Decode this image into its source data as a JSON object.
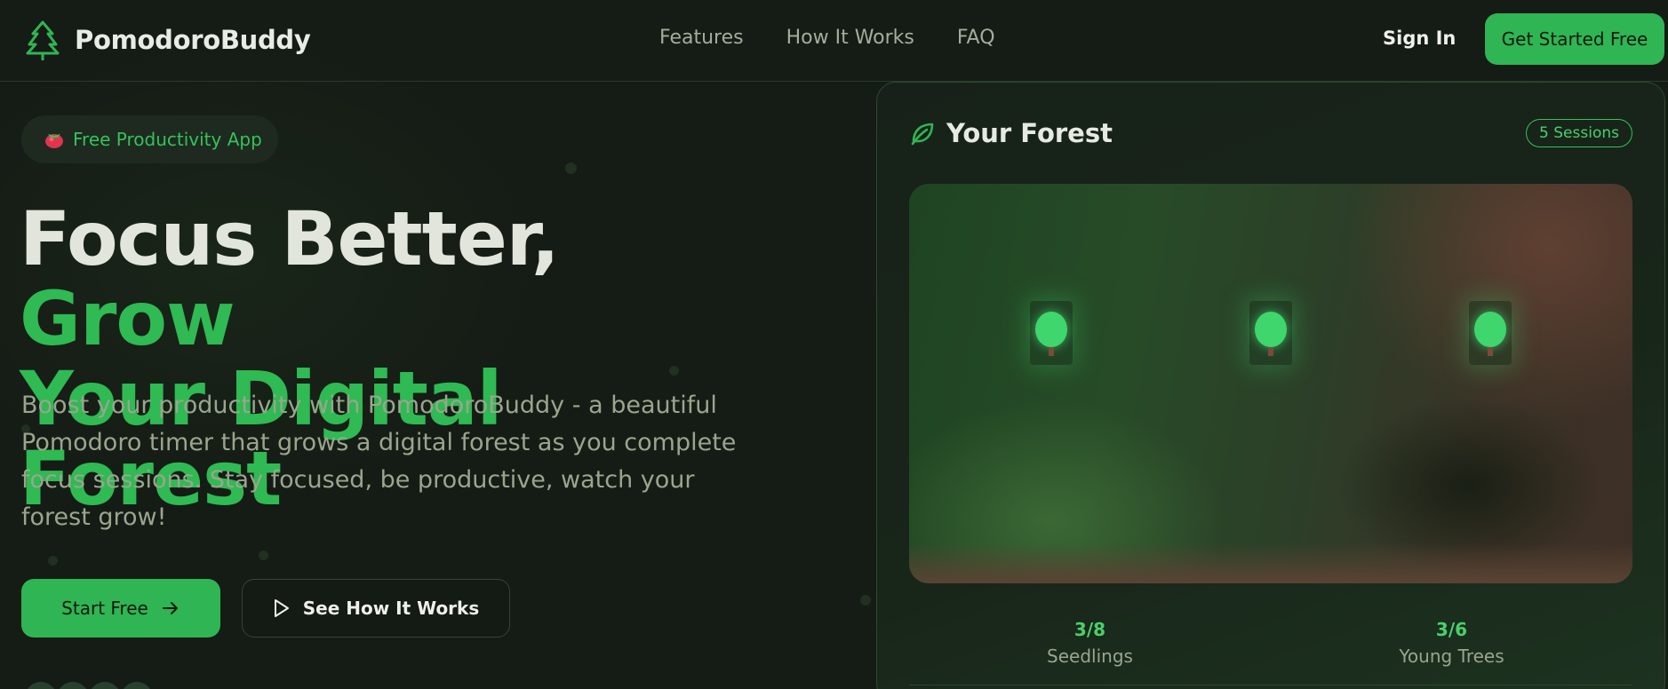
{
  "brand": {
    "name": "PomodoroBuddy",
    "icon": "pine-tree-icon",
    "accent": "#2fb553"
  },
  "nav": {
    "links": [
      {
        "label": "Features"
      },
      {
        "label": "How It Works"
      },
      {
        "label": "FAQ"
      }
    ],
    "sign_in": "Sign In",
    "cta": "Get Started Free"
  },
  "hero": {
    "badge": {
      "icon": "tomato-emoji",
      "label": "Free Productivity App"
    },
    "headline_white": "Focus Better, ",
    "headline_green_1": "Grow",
    "headline_green_2": "Your Digital Forest",
    "subtext": "Boost your productivity with PomodoroBuddy - a beautiful Pomodoro timer that grows a digital forest as you complete focus sessions. Stay focused, be productive, watch your forest grow!",
    "primary_button": {
      "label": "Start Free",
      "icon": "arrow-right-icon"
    },
    "secondary_button": {
      "label": "See How It Works",
      "icon": "play-icon"
    }
  },
  "forest_card": {
    "icon": "leaf-icon",
    "title": "Your Forest",
    "sessions_badge": "5 Sessions",
    "trees_shown": 3,
    "stats": [
      {
        "value": "3/8",
        "label": "Seedlings"
      },
      {
        "value": "3/6",
        "label": "Young Trees"
      }
    ]
  }
}
